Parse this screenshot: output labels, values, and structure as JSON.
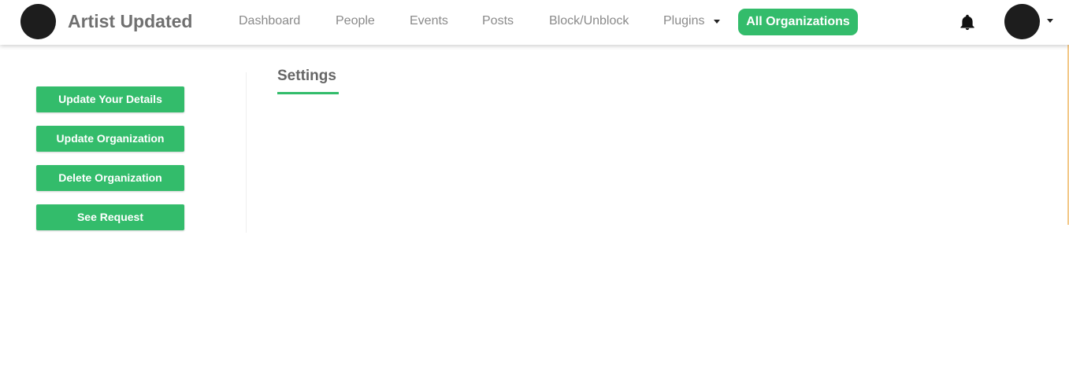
{
  "brand": {
    "title": "Artist Updated"
  },
  "nav": {
    "links": [
      "Dashboard",
      "People",
      "Events",
      "Posts",
      "Block/Unblock",
      "Plugins"
    ],
    "active": "All Organizations",
    "icons": [
      "bell-icon",
      "chevron-down-icon"
    ]
  },
  "sidebar": {
    "buttons": [
      "Update Your Details",
      "Update Organization",
      "Delete Organization",
      "See Request"
    ]
  },
  "main": {
    "title": "Settings"
  },
  "colors": {
    "accent": "#33bc6b",
    "brand_text": "#707070",
    "nav_text": "#8a8a8a",
    "avatar": "#1d1d1d"
  }
}
